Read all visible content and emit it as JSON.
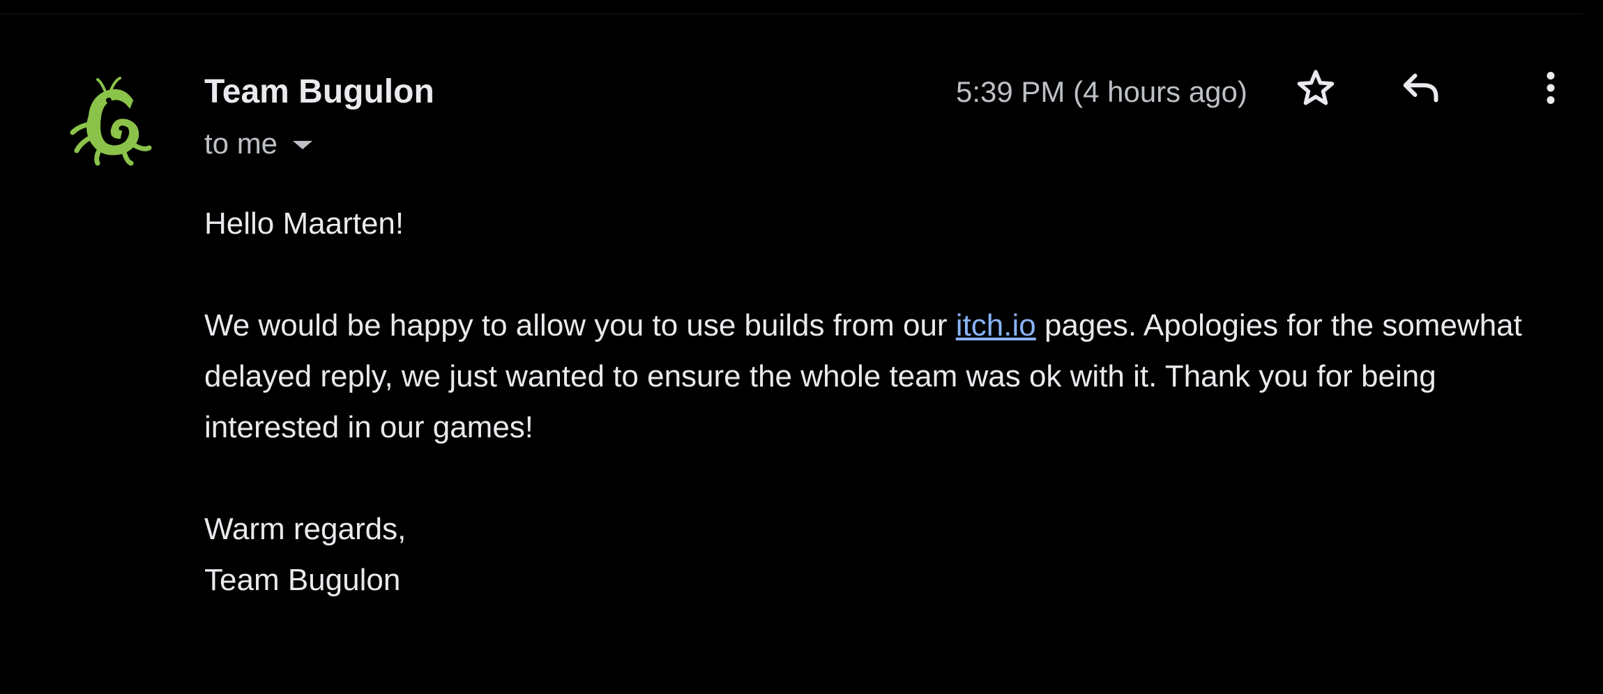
{
  "message": {
    "sender": {
      "name": "Team Bugulon",
      "avatar_icon": "bug-creature-logo",
      "avatar_color": "#8bc34a"
    },
    "recipient_label": "to me",
    "timestamp": "5:39 PM (4 hours ago)",
    "actions": {
      "star_icon": "star-outline-icon",
      "reply_icon": "reply-arrow-icon",
      "more_icon": "more-vertical-icon"
    },
    "body": {
      "greeting": "Hello Maarten!",
      "paragraph_before_link": "We would be happy to allow you to use builds from our ",
      "link_text": "itch.io",
      "paragraph_after_link": " pages. Apologies for the somewhat delayed reply, we just wanted to ensure the whole team was ok with it. Thank you for being interested in our games!",
      "closing": "Warm regards,",
      "signature": "Team Bugulon"
    }
  },
  "colors": {
    "background": "#000000",
    "text_primary": "#e8eaed",
    "text_secondary": "#bdc1c6",
    "link": "#8ab4f8"
  }
}
